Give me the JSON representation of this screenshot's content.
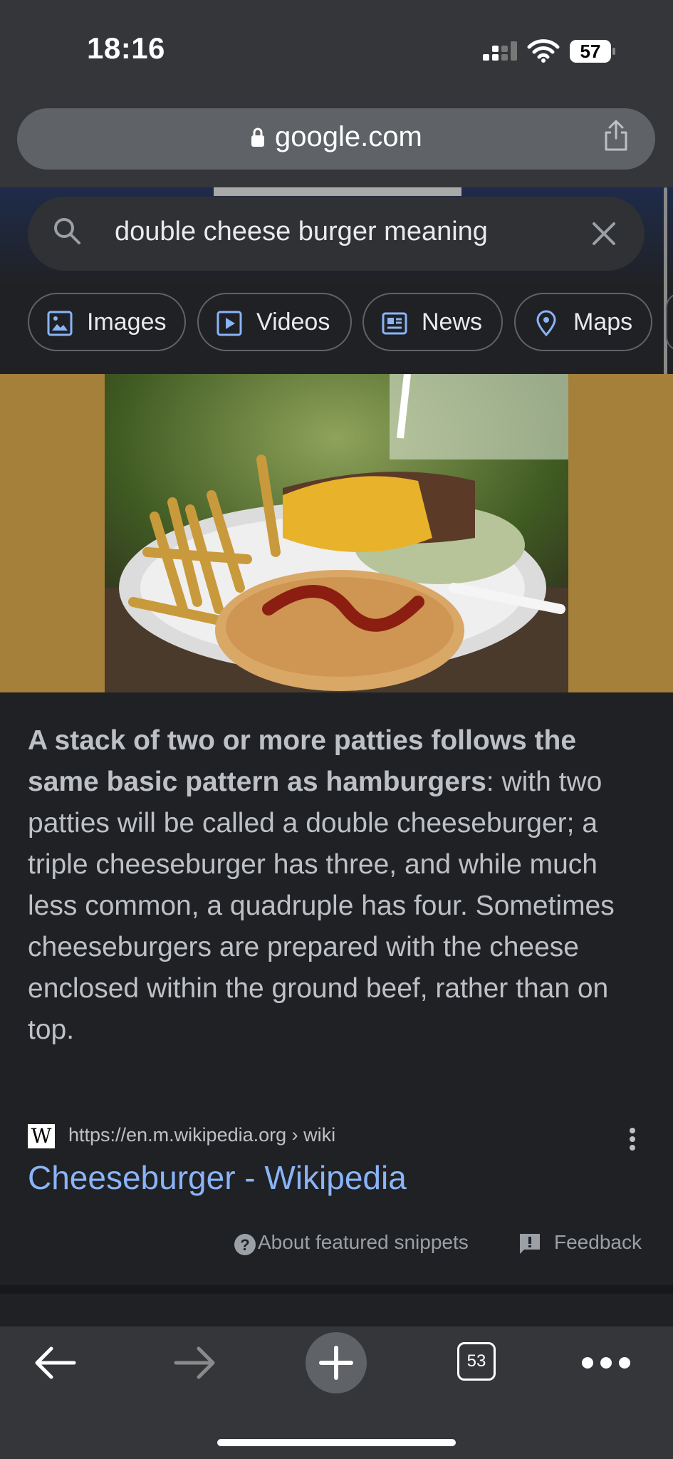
{
  "status_bar": {
    "time": "18:16",
    "battery_level": "57"
  },
  "address_bar": {
    "domain": "google.com"
  },
  "search": {
    "query": "double cheese burger meaning"
  },
  "filter_chips": [
    {
      "label": "Images",
      "icon": "image-icon"
    },
    {
      "label": "Videos",
      "icon": "video-icon"
    },
    {
      "label": "News",
      "icon": "news-icon"
    },
    {
      "label": "Maps",
      "icon": "map-pin-icon"
    }
  ],
  "featured_snippet": {
    "bold_text": "A stack of two or more patties follows the same basic pattern as hamburgers",
    "body_text": ": with two patties will be called a double cheeseburger; a triple cheeseburger has three, and while much less common, a quadruple has four. Sometimes cheeseburgers are prepared with the cheese enclosed within the ground beef, rather than on top.",
    "favicon_letter": "W",
    "source_url": "https://en.m.wikipedia.org › wiki",
    "title": "Cheeseburger - Wikipedia",
    "about_label": "About featured snippets",
    "feedback_label": "Feedback"
  },
  "toolbar": {
    "tab_count": "53"
  },
  "colors": {
    "link": "#8ab4f8",
    "background": "#202124",
    "chrome": "#35363a",
    "image_band": "#a5803b"
  }
}
